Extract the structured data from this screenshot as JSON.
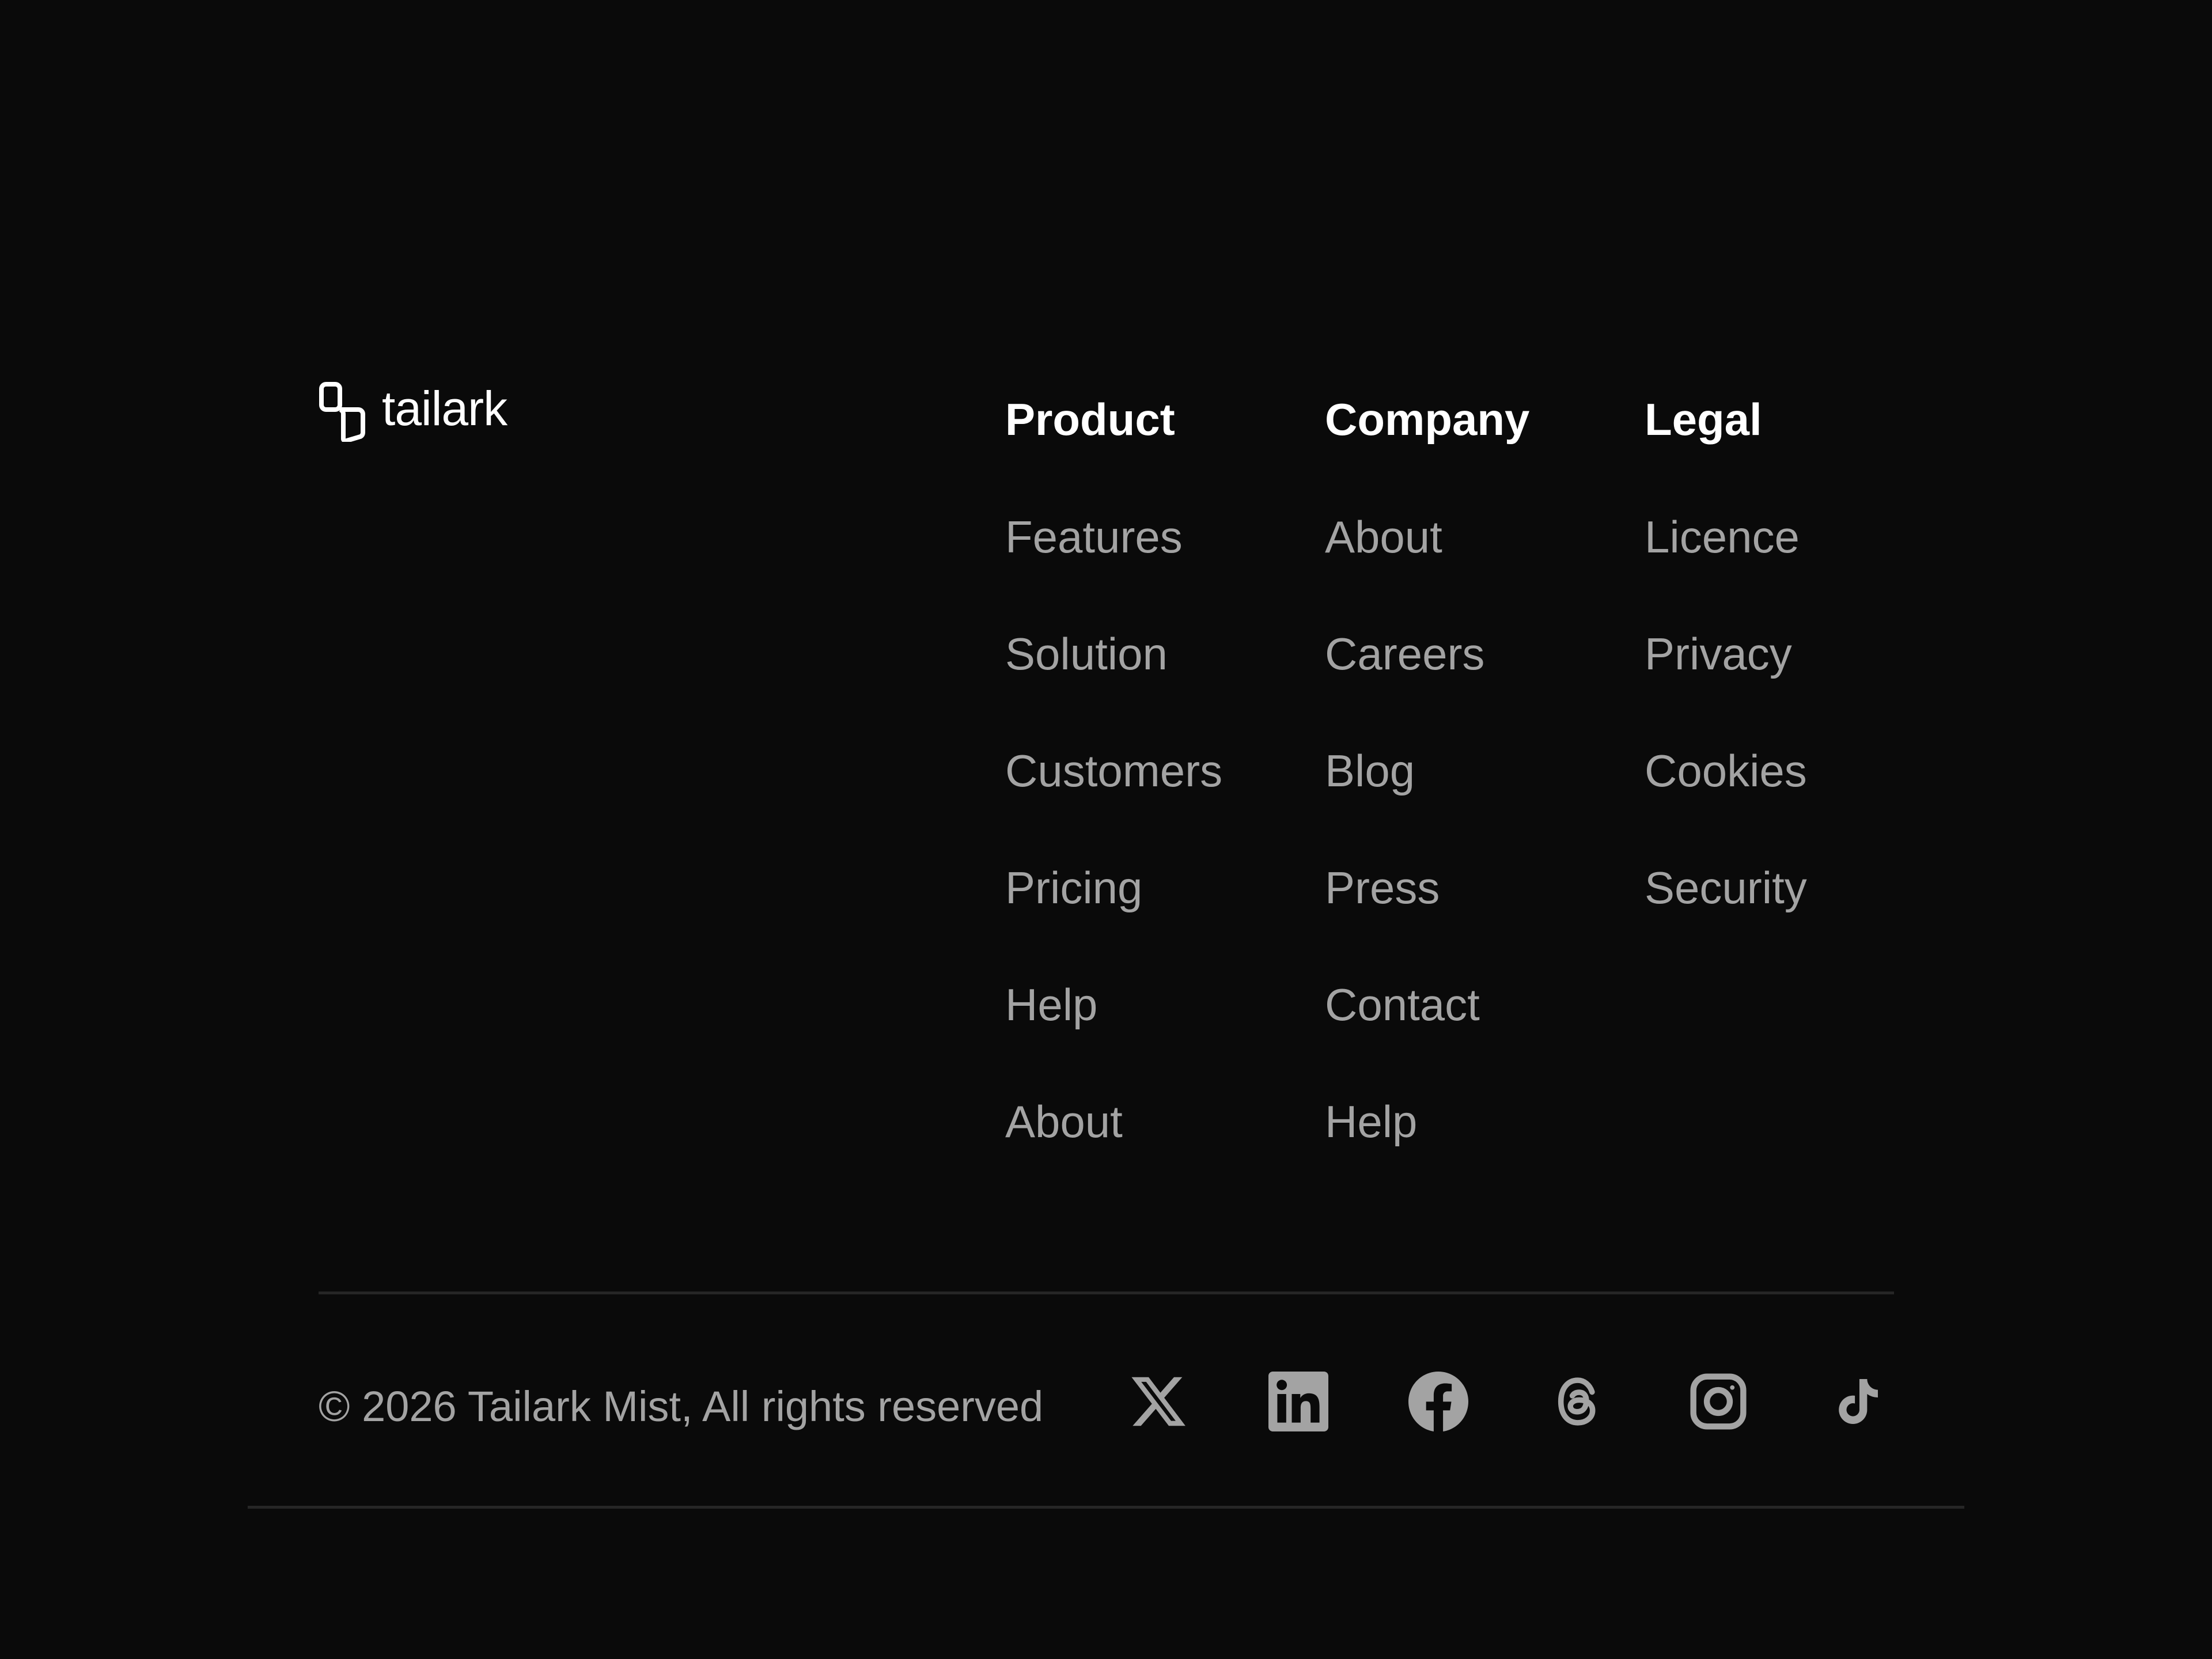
{
  "brand": {
    "name": "tailark"
  },
  "columns": [
    {
      "heading": "Product",
      "links": [
        "Features",
        "Solution",
        "Customers",
        "Pricing",
        "Help",
        "About"
      ]
    },
    {
      "heading": "Company",
      "links": [
        "About",
        "Careers",
        "Blog",
        "Press",
        "Contact",
        "Help"
      ]
    },
    {
      "heading": "Legal",
      "links": [
        "Licence",
        "Privacy",
        "Cookies",
        "Security"
      ]
    }
  ],
  "copyright": "© 2026 Tailark Mist, All rights reserved",
  "socials": [
    {
      "icon": "x-icon"
    },
    {
      "icon": "linkedin-icon"
    },
    {
      "icon": "facebook-icon"
    },
    {
      "icon": "threads-icon"
    },
    {
      "icon": "instagram-icon"
    },
    {
      "icon": "tiktok-icon"
    }
  ],
  "colors": {
    "background": "#0a0a0a",
    "heading": "#ffffff",
    "link": "#a3a3a3",
    "divider": "#262626"
  }
}
